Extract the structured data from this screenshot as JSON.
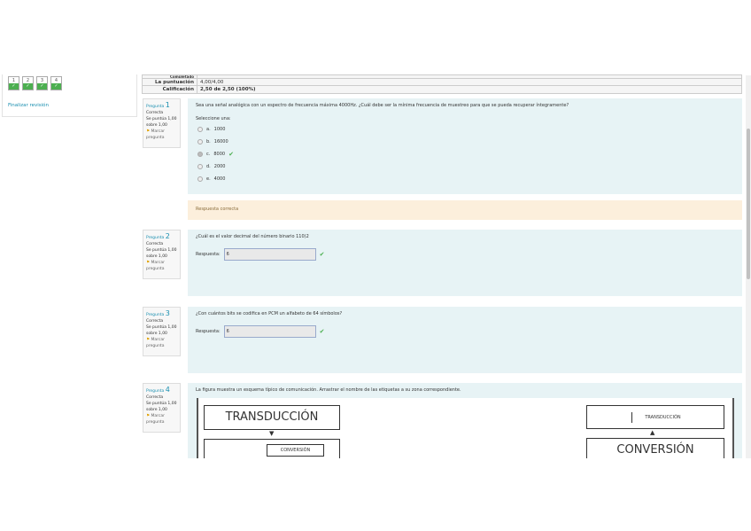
{
  "nav": {
    "buttons": [
      "1",
      "2",
      "3",
      "4"
    ],
    "finish": "Finalizar revisión"
  },
  "summary": {
    "rows": [
      {
        "k": "Completado",
        "v": ""
      },
      {
        "k": "La puntuación",
        "v": "4,00/4,00"
      },
      {
        "k": "Calificación",
        "v": "2,50 de 2,50 (100%)"
      }
    ]
  },
  "questions": [
    {
      "label": "Pregunta",
      "num": "1",
      "state": "Correcta",
      "score": "Se puntúa 1,00 sobre 1,00",
      "flag": "Marcar pregunta",
      "text": "Sea una señal analógica con un espectro de frecuencia máxima 4000Hz. ¿Cuál debe ser la mínima frecuencia de muestreo para que se pueda recuperar íntegramente?",
      "prompt": "Seleccione una:",
      "options": [
        {
          "l": "a.",
          "v": "1000"
        },
        {
          "l": "b.",
          "v": "16000"
        },
        {
          "l": "c.",
          "v": "8000"
        },
        {
          "l": "d.",
          "v": "2000"
        },
        {
          "l": "e.",
          "v": "4000"
        }
      ],
      "feedback": "Respuesta correcta"
    },
    {
      "label": "Pregunta",
      "num": "2",
      "state": "Correcta",
      "score": "Se puntúa 1,00 sobre 1,00",
      "flag": "Marcar pregunta",
      "text": "¿Cuál es el valor decimal del número binario 110)2",
      "answer_label": "Respuesta:",
      "answer": "6"
    },
    {
      "label": "Pregunta",
      "num": "3",
      "state": "Correcta",
      "score": "Se puntúa 1,00 sobre 1,00",
      "flag": "Marcar pregunta",
      "text": "¿Con cuántos bits se codifica en PCM un alfabeto de 64 símbolos?",
      "answer_label": "Respuesta:",
      "answer": "6"
    },
    {
      "label": "Pregunta",
      "num": "4",
      "state": "Correcta",
      "score": "Se puntúa 1,00 sobre 1,00",
      "flag": "Marcar pregunta",
      "text": "La figura muestra un esquema típico de comunicación. Arrastrar el nombre de las etiquetas a su zona correspondiente.",
      "diagram": {
        "left_top": "TRANSDUCCIÓN",
        "left_drop": "CONVERSIÓN",
        "right_drop": "TRANSDUCCIÓN",
        "right_bottom": "CONVERSIÓN"
      }
    }
  ]
}
